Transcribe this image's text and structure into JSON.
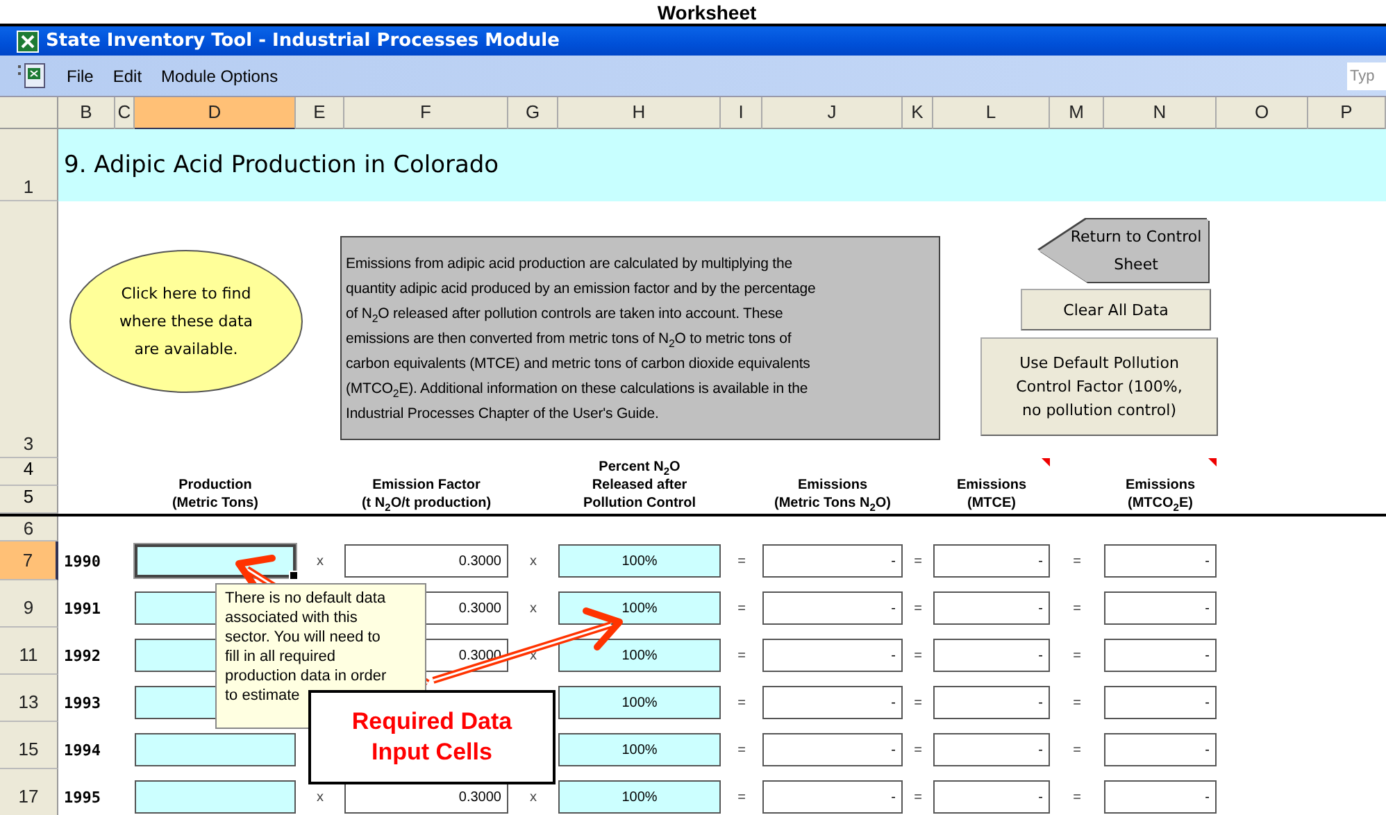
{
  "page_heading": "Worksheet",
  "window": {
    "title": "State Inventory Tool - Industrial Processes Module"
  },
  "menu": [
    {
      "label": "File"
    },
    {
      "label": "Edit"
    },
    {
      "label": "Module Options"
    }
  ],
  "help_search": {
    "placeholder": "Typ"
  },
  "columns": [
    {
      "label": "B",
      "selected": false
    },
    {
      "label": "C",
      "selected": false
    },
    {
      "label": "D",
      "selected": true
    },
    {
      "label": "E",
      "selected": false
    },
    {
      "label": "F",
      "selected": false
    },
    {
      "label": "G",
      "selected": false
    },
    {
      "label": "H",
      "selected": false
    },
    {
      "label": "I",
      "selected": false
    },
    {
      "label": "J",
      "selected": false
    },
    {
      "label": "K",
      "selected": false
    },
    {
      "label": "L",
      "selected": false
    },
    {
      "label": "M",
      "selected": false
    },
    {
      "label": "N",
      "selected": false
    },
    {
      "label": "O",
      "selected": false
    },
    {
      "label": "P",
      "selected": false
    }
  ],
  "sheet_title": {
    "row": "1",
    "text": "9. Adipic Acid Production in Colorado"
  },
  "info_row": "3",
  "info_link": "Click here to find where these data are available.",
  "description": "Emissions from adipic acid production are calculated by multiplying the\nquantity adipic acid produced by an emission factor and by the percentage\nof N$_{2}$O released after pollution controls are taken into account.  These\nemissions are then converted from metric tons of N$_{2}$O to metric tons of\ncarbon equivalents (MTCE) and metric tons of carbon dioxide equivalents\n(MTCO$_{2}$E).  Additional information on these calculations is available in the\nIndustrial Processes Chapter of the User's Guide.",
  "buttons": {
    "return": "Return to Control\nSheet",
    "clear": "Clear All Data",
    "use_default": "Use Default Pollution\nControl Factor (100%,\nno pollution control)"
  },
  "header_rows": [
    "4",
    "5"
  ],
  "blank_row": "6",
  "headers": [
    {
      "text": "Production\n(Metric Tons)",
      "has_comment": false
    },
    {
      "text": "Emission Factor\n(t N$_{2}$O/t production)",
      "has_comment": false
    },
    {
      "text": "Percent N$_{2}$O\nReleased after\nPollution Control",
      "has_comment": false
    },
    {
      "text": "Emissions\n(Metric Tons N$_{2}$O)",
      "has_comment": false
    },
    {
      "text": "Emissions\n(MTCE)",
      "has_comment": true
    },
    {
      "text": "Emissions\n(MTCO$_{2}$E)",
      "has_comment": true
    }
  ],
  "rows": [
    {
      "row": "7",
      "selected": true,
      "year": "1990",
      "op1": "x",
      "factor": "0.3000",
      "op2": "x",
      "percent": "100%",
      "op3": "=",
      "emissions_n2o": "-",
      "op4": "=",
      "mtce": "-",
      "op5": "=",
      "mtco2e": "-"
    },
    {
      "row": "9",
      "selected": false,
      "year": "1991",
      "factor": "0.3000",
      "op2": "x",
      "percent": "100%",
      "op3": "=",
      "emissions_n2o": "-",
      "op4": "=",
      "mtce": "-",
      "op5": "=",
      "mtco2e": "-"
    },
    {
      "row": "11",
      "selected": false,
      "year": "1992",
      "factor": "0.3000",
      "op2": "x",
      "percent": "100%",
      "op3": "=",
      "emissions_n2o": "-",
      "op4": "=",
      "mtce": "-",
      "op5": "=",
      "mtco2e": "-"
    },
    {
      "row": "13",
      "selected": false,
      "year": "1993",
      "percent": "100%",
      "op3": "=",
      "emissions_n2o": "-",
      "op4": "=",
      "mtce": "-",
      "op5": "=",
      "mtco2e": "-"
    },
    {
      "row": "15",
      "selected": false,
      "year": "1994",
      "percent": "100%",
      "op3": "=",
      "emissions_n2o": "-",
      "op4": "=",
      "mtce": "-",
      "op5": "=",
      "mtco2e": "-"
    },
    {
      "row": "17",
      "selected": false,
      "year": "1995",
      "op1": "x",
      "factor": "0.3000",
      "op2": "x",
      "percent": "100%",
      "op3": "=",
      "emissions_n2o": "-",
      "op4": "=",
      "mtce": "-",
      "op5": "=",
      "mtco2e": "-"
    }
  ],
  "tooltip": "There is no default data\nassociated with this\nsector.  You will need to\nfill in all required\nproduction data in order\nto estimate",
  "callout": "Required Data Input Cells"
}
